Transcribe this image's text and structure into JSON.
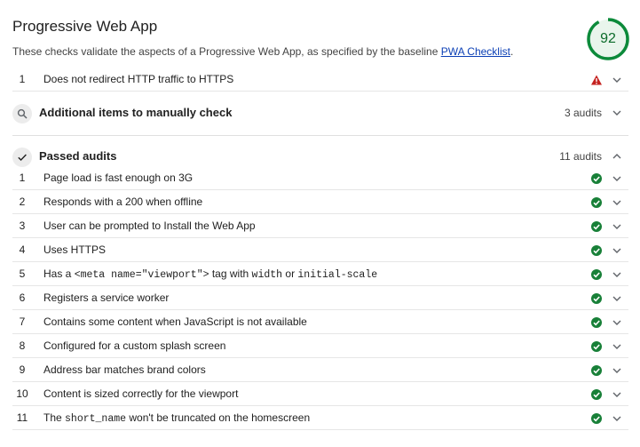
{
  "header": {
    "title": "Progressive Web App",
    "description_prefix": "These checks validate the aspects of a Progressive Web App, as specified by the baseline ",
    "link_text": "PWA Checklist",
    "description_suffix": "."
  },
  "score": {
    "value": "92",
    "fraction": 0.92,
    "color": "#0c6b2a"
  },
  "failed": [
    {
      "index": "1",
      "label": "Does not redirect HTTP traffic to HTTPS",
      "status": "warning-icon"
    }
  ],
  "manual_group": {
    "title": "Additional items to manually check",
    "count": "3 audits",
    "icon": "search-icon",
    "expanded": false
  },
  "passed_group": {
    "title": "Passed audits",
    "count": "11 audits",
    "icon": "check-icon",
    "expanded": true
  },
  "passed": [
    {
      "index": "1",
      "parts": [
        {
          "t": "Page load is fast enough on 3G"
        }
      ]
    },
    {
      "index": "2",
      "parts": [
        {
          "t": "Responds with a 200 when offline"
        }
      ]
    },
    {
      "index": "3",
      "parts": [
        {
          "t": "User can be prompted to Install the Web App"
        }
      ]
    },
    {
      "index": "4",
      "parts": [
        {
          "t": "Uses HTTPS"
        }
      ]
    },
    {
      "index": "5",
      "parts": [
        {
          "t": "Has a "
        },
        {
          "t": "<meta name=\"viewport\">",
          "code": true
        },
        {
          "t": " tag with "
        },
        {
          "t": "width",
          "code": true
        },
        {
          "t": " or "
        },
        {
          "t": "initial-scale",
          "code": true
        }
      ]
    },
    {
      "index": "6",
      "parts": [
        {
          "t": "Registers a service worker"
        }
      ]
    },
    {
      "index": "7",
      "parts": [
        {
          "t": "Contains some content when JavaScript is not available"
        }
      ]
    },
    {
      "index": "8",
      "parts": [
        {
          "t": "Configured for a custom splash screen"
        }
      ]
    },
    {
      "index": "9",
      "parts": [
        {
          "t": "Address bar matches brand colors"
        }
      ]
    },
    {
      "index": "10",
      "parts": [
        {
          "t": "Content is sized correctly for the viewport"
        }
      ]
    },
    {
      "index": "11",
      "parts": [
        {
          "t": "The "
        },
        {
          "t": "short_name",
          "code": true
        },
        {
          "t": " won't be truncated on the homescreen"
        }
      ]
    }
  ],
  "colors": {
    "pass": "#188038",
    "fail": "#c5221f",
    "link": "#0b3fb5",
    "gauge_track": "#e0f2e6",
    "gauge_arc": "#0c8a3a"
  }
}
